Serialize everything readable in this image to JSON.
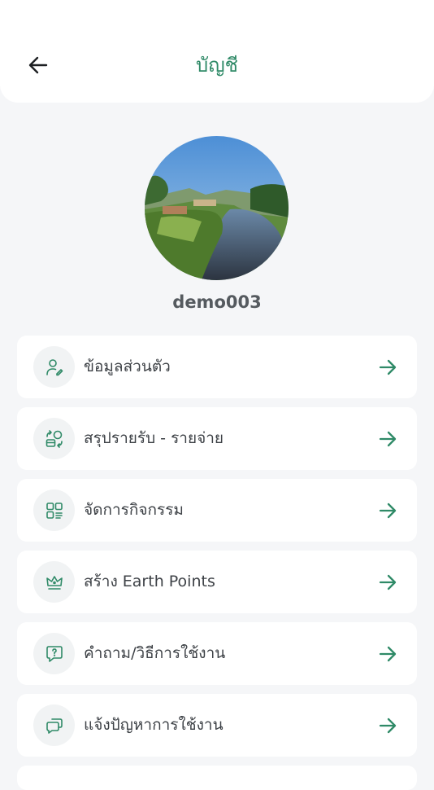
{
  "header": {
    "title": "บัญชี",
    "back_icon": "arrow-left-icon"
  },
  "profile": {
    "username": "demo003"
  },
  "menu": {
    "items": [
      {
        "label": "ข้อมูลส่วนตัว",
        "icon": "user-edit-icon"
      },
      {
        "label": "สรุปรายรับ - รายจ่าย",
        "icon": "money-exchange-icon"
      },
      {
        "label": "จัดการกิจกรรม",
        "icon": "grid-list-icon"
      },
      {
        "label": "สร้าง Earth Points",
        "icon": "crown-icon"
      },
      {
        "label": "คำถาม/วิธีการใช้งาน",
        "icon": "question-chat-icon"
      },
      {
        "label": "แจ้งปัญหาการใช้งาน",
        "icon": "chat-bubbles-icon"
      }
    ]
  },
  "colors": {
    "accent": "#2f8a67",
    "background": "#f5f6f8",
    "card": "#ffffff"
  }
}
